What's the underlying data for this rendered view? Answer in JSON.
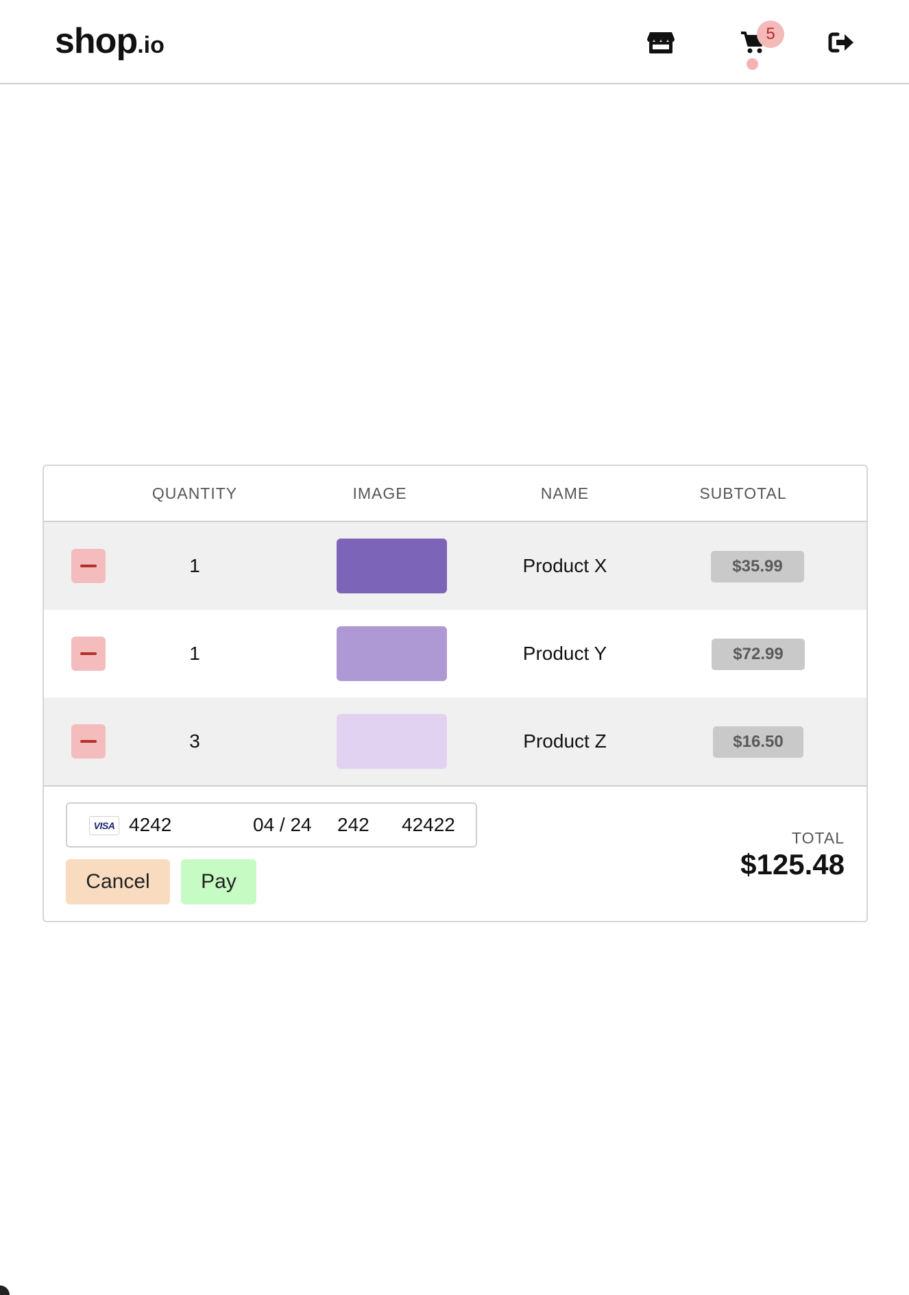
{
  "header": {
    "logo_main": "shop",
    "logo_tld": ".io",
    "nav": [
      {
        "icon": "store-icon"
      },
      {
        "icon": "cart-icon",
        "badge": "5"
      },
      {
        "icon": "logout-icon"
      }
    ]
  },
  "cart": {
    "columns": [
      "QUANTITY",
      "IMAGE",
      "NAME",
      "SUBTOTAL"
    ],
    "items": [
      {
        "quantity": "1",
        "name": "Product X",
        "subtotal": "$35.99",
        "image_color": "#7c65b8"
      },
      {
        "quantity": "1",
        "name": "Product Y",
        "subtotal": "$72.99",
        "image_color": "#af99d4"
      },
      {
        "quantity": "3",
        "name": "Product Z",
        "subtotal": "$16.50",
        "image_color": "#e0d2f0"
      }
    ],
    "payment": {
      "card_brand": "VISA",
      "card_number": "4242",
      "expiry": "04 / 24",
      "cvc": "242",
      "zip": "42422"
    },
    "cancel_label": "Cancel",
    "pay_label": "Pay",
    "total_label": "TOTAL",
    "total_value": "$125.48"
  },
  "colors": {
    "remove_button": "#f4bcbc",
    "cancel_button": "#f9dcc0",
    "pay_button": "#c6fbc4",
    "badge": "#f4b9b9"
  }
}
